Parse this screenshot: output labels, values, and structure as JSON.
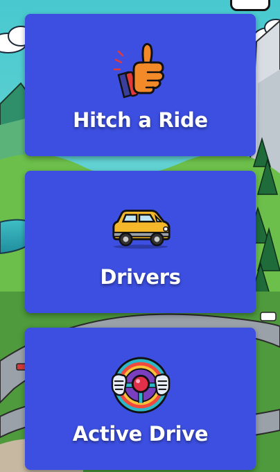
{
  "menu": {
    "items": [
      {
        "label": "Hitch a Ride",
        "icon": "thumbs-up-icon"
      },
      {
        "label": "Drivers",
        "icon": "car-icon"
      },
      {
        "label": "Active Drive",
        "icon": "steering-wheel-icon"
      }
    ]
  },
  "colors": {
    "card_background": "#3c4fe0",
    "label_text": "#ffffff"
  }
}
